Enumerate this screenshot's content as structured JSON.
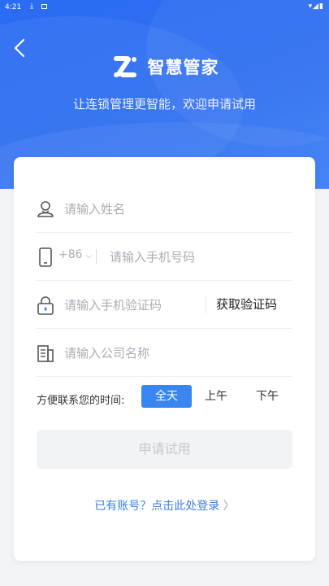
{
  "status_bar": {
    "time": "4:21",
    "download_icon": "download-icon",
    "right_icons": "▾◢▮"
  },
  "header": {
    "back_icon": "chevron-left-icon",
    "logo_icon": "smart-butler-logo",
    "app_name": "智慧管家",
    "tagline": "让连锁管理更智能，欢迎申请试用",
    "background_color": "#2f6ff0"
  },
  "form": {
    "name": {
      "icon": "user-icon",
      "placeholder": "请输入姓名"
    },
    "phone": {
      "icon": "phone-icon",
      "country_code": "+86",
      "dropdown_icon": "chevron-down-icon",
      "placeholder": "请输入手机号码"
    },
    "sms_code": {
      "icon": "lock-icon",
      "placeholder": "请输入手机验证码",
      "get_code_label": "获取验证码"
    },
    "company": {
      "icon": "building-icon",
      "placeholder": "请输入公司名称"
    },
    "contact_time": {
      "label": "方便联系您的时间:",
      "options": [
        "全天",
        "上午",
        "下午"
      ],
      "selected": "全天",
      "accent_color": "#3a86f0"
    },
    "submit_label": "申请试用",
    "login_link": "已有账号？点击此处登录"
  }
}
